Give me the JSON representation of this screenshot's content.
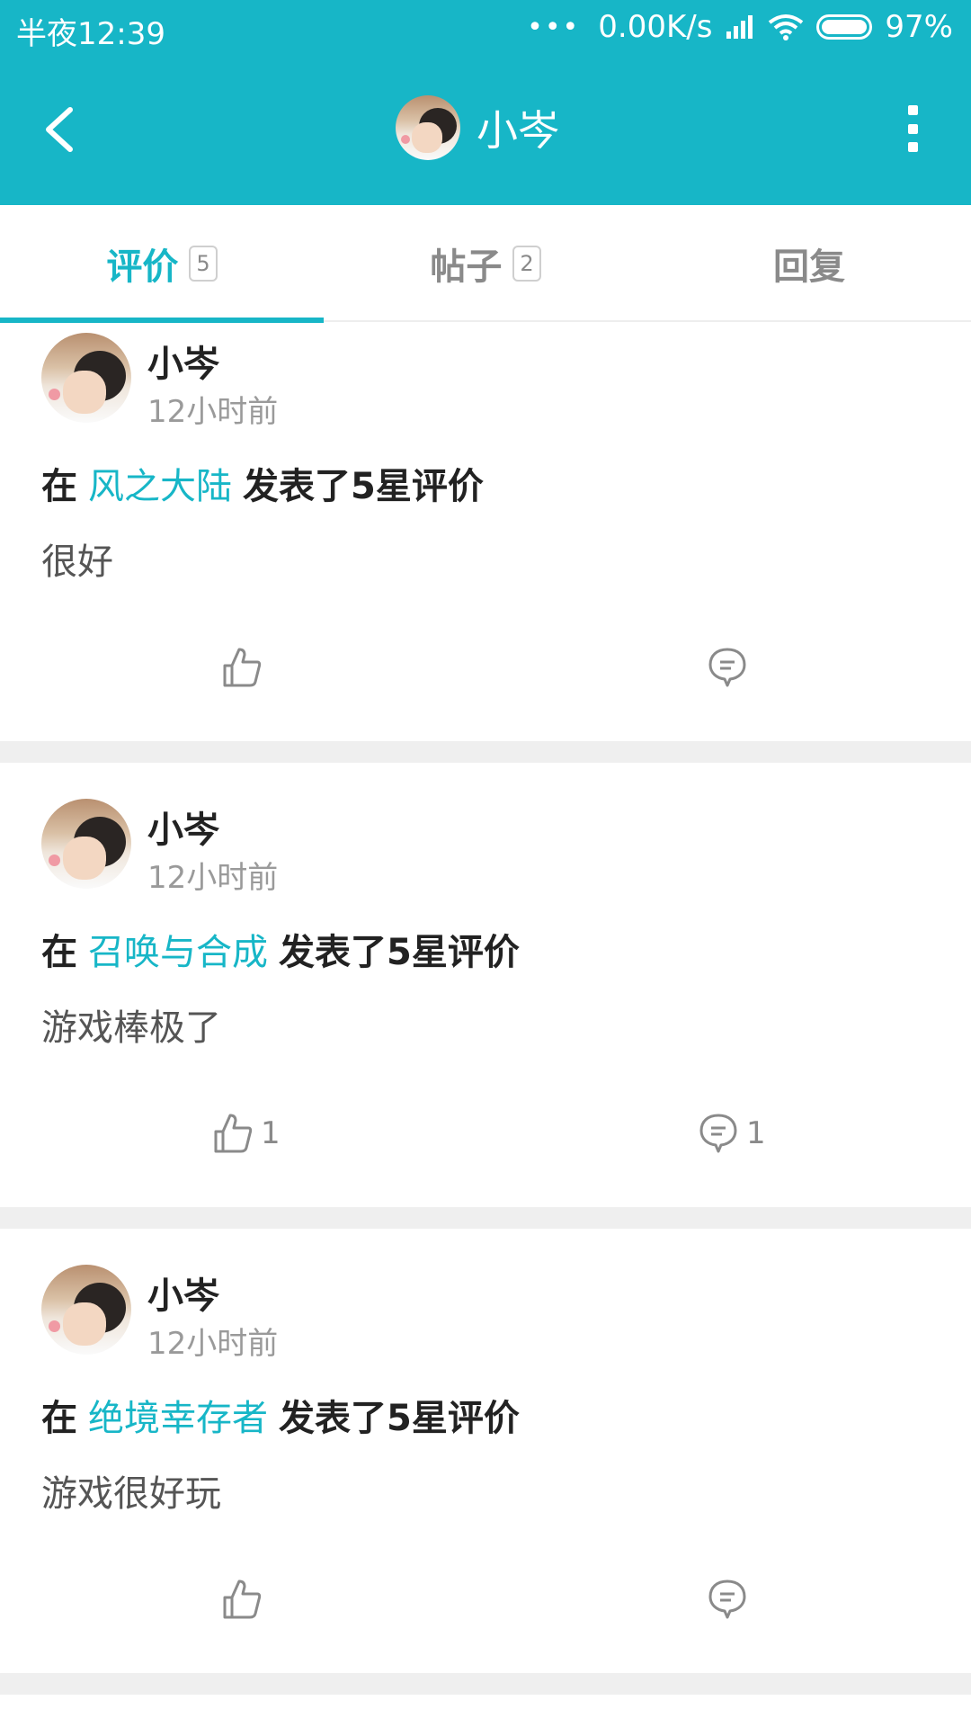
{
  "status_bar": {
    "time": "半夜12:39",
    "network_speed": "0.00K/s",
    "battery": "97%"
  },
  "nav": {
    "title": "小岑",
    "back_icon": "chevron-left-icon",
    "more_icon": "more-vertical-icon"
  },
  "tabs": [
    {
      "label": "评价",
      "badge": "5",
      "active": true
    },
    {
      "label": "帖子",
      "badge": "2",
      "active": false
    },
    {
      "label": "回复",
      "badge": "",
      "active": false
    }
  ],
  "colors": {
    "accent": "#17b6c7",
    "background": "#ffffff",
    "divider": "#efefef"
  },
  "cards": [
    {
      "user_name": "小岑",
      "time": "12小时前",
      "prefix": "在",
      "game": "风之大陆",
      "suffix": "发表了5星评价",
      "body": "很好",
      "like_count": "",
      "comment_count": ""
    },
    {
      "user_name": "小岑",
      "time": "12小时前",
      "prefix": "在",
      "game": "召唤与合成",
      "suffix": "发表了5星评价",
      "body": "游戏棒极了",
      "like_count": "1",
      "comment_count": "1"
    },
    {
      "user_name": "小岑",
      "time": "12小时前",
      "prefix": "在",
      "game": "绝境幸存者",
      "suffix": "发表了5星评价",
      "body": "游戏很好玩",
      "like_count": "",
      "comment_count": ""
    }
  ]
}
